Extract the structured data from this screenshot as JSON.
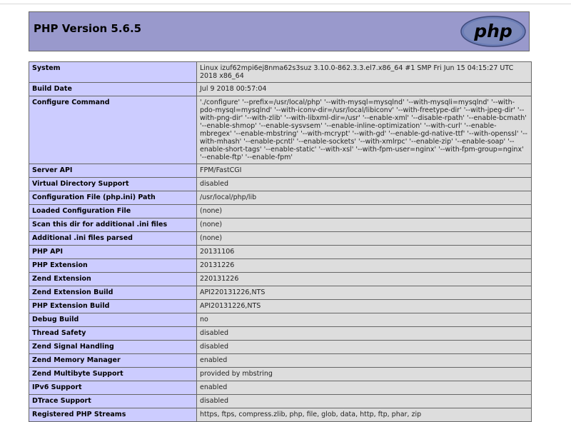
{
  "header": {
    "title": "PHP Version 5.6.5",
    "logo_text": "php"
  },
  "rows": [
    {
      "key": "System",
      "value": "Linux izuf62mpi6ej8nma62s3suz 3.10.0-862.3.3.el7.x86_64 #1 SMP Fri Jun 15 04:15:27 UTC 2018 x86_64"
    },
    {
      "key": "Build Date",
      "value": "Jul 9 2018 00:57:04"
    },
    {
      "key": "Configure Command",
      "value": "'./configure' '--prefix=/usr/local/php' '--with-mysql=mysqlnd' '--with-mysqli=mysqlnd' '--with-pdo-mysql=mysqlnd' '--with-iconv-dir=/usr/local/libiconv' '--with-freetype-dir' '--with-jpeg-dir' '--with-png-dir' '--with-zlib' '--with-libxml-dir=/usr' '--enable-xml' '--disable-rpath' '--enable-bcmath' '--enable-shmop' '--enable-sysvsem' '--enable-inline-optimization' '--with-curl' '--enable-mbregex' '--enable-mbstring' '--with-mcrypt' '--with-gd' '--enable-gd-native-ttf' '--with-openssl' '--with-mhash' '--enable-pcntl' '--enable-sockets' '--with-xmlrpc' '--enable-zip' '--enable-soap' '--enable-short-tags' '--enable-static' '--with-xsl' '--with-fpm-user=nginx' '--with-fpm-group=nginx' '--enable-ftp' '--enable-fpm'"
    },
    {
      "key": "Server API",
      "value": "FPM/FastCGI"
    },
    {
      "key": "Virtual Directory Support",
      "value": "disabled"
    },
    {
      "key": "Configuration File (php.ini) Path",
      "value": "/usr/local/php/lib"
    },
    {
      "key": "Loaded Configuration File",
      "value": "(none)"
    },
    {
      "key": "Scan this dir for additional .ini files",
      "value": "(none)"
    },
    {
      "key": "Additional .ini files parsed",
      "value": "(none)"
    },
    {
      "key": "PHP API",
      "value": "20131106"
    },
    {
      "key": "PHP Extension",
      "value": "20131226"
    },
    {
      "key": "Zend Extension",
      "value": "220131226"
    },
    {
      "key": "Zend Extension Build",
      "value": "API220131226,NTS"
    },
    {
      "key": "PHP Extension Build",
      "value": "API20131226,NTS"
    },
    {
      "key": "Debug Build",
      "value": "no"
    },
    {
      "key": "Thread Safety",
      "value": "disabled"
    },
    {
      "key": "Zend Signal Handling",
      "value": "disabled"
    },
    {
      "key": "Zend Memory Manager",
      "value": "enabled"
    },
    {
      "key": "Zend Multibyte Support",
      "value": "provided by mbstring"
    },
    {
      "key": "IPv6 Support",
      "value": "enabled"
    },
    {
      "key": "DTrace Support",
      "value": "disabled"
    },
    {
      "key": "Registered PHP Streams",
      "value": "https, ftps, compress.zlib, php, file, glob, data, http, ftp, phar, zip"
    }
  ]
}
